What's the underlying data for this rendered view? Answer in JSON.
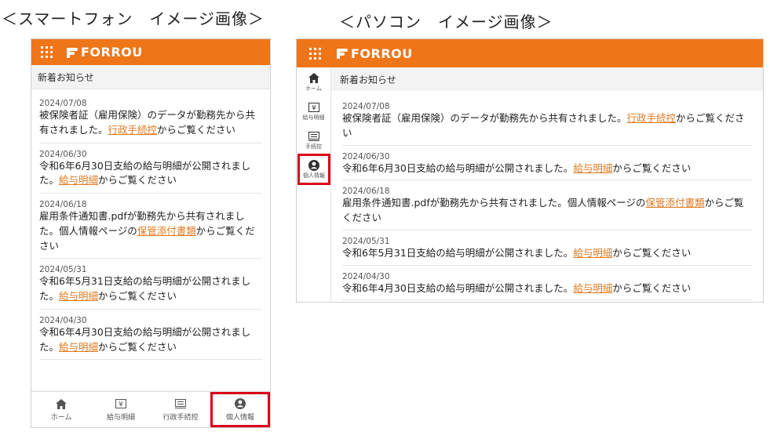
{
  "captions": {
    "smartphone": "＜スマートフォン　イメージ画像＞",
    "pc": "＜パソコン　イメージ画像＞"
  },
  "app": {
    "logo_text": "FORROU"
  },
  "section_title": "新着お知らせ",
  "phone_notices": [
    {
      "date": "2024/07/08",
      "before": "被保険者証（雇用保険）のデータが勤務先から共有されました。",
      "link": "行政手続控",
      "after": "からご覧ください"
    },
    {
      "date": "2024/06/30",
      "before": "令和6年6月30日支給の給与明細が公開されました。",
      "link": "給与明細",
      "after": "からご覧ください"
    },
    {
      "date": "2024/06/18",
      "before": "雇用条件通知書.pdfが勤務先から共有されました。個人情報ページの",
      "link": "保管添付書類",
      "after": "からご覧ください"
    },
    {
      "date": "2024/05/31",
      "before": "令和6年5月31日支給の給与明細が公開されました。",
      "link": "給与明細",
      "after": "からご覧ください"
    },
    {
      "date": "2024/04/30",
      "before": "令和6年4月30日支給の給与明細が公開されました。",
      "link": "給与明細",
      "after": "からご覧ください"
    }
  ],
  "tabs": [
    {
      "label": "ホーム",
      "icon": "home-icon"
    },
    {
      "label": "給与明細",
      "icon": "yen-icon"
    },
    {
      "label": "行政手続控",
      "icon": "document-icon"
    },
    {
      "label": "個人情報",
      "icon": "person-icon",
      "highlighted": true
    }
  ],
  "side_nav": [
    {
      "label": "ホーム",
      "icon": "home-icon"
    },
    {
      "label": "給与明細",
      "icon": "yen-icon"
    },
    {
      "label": "手続控",
      "icon": "document-icon"
    },
    {
      "label": "個人情報",
      "icon": "person-icon",
      "highlighted": true
    }
  ],
  "pc_notices": [
    {
      "date": "2024/07/08",
      "before": "被保険者証（雇用保険）のデータが勤務先から共有されました。",
      "link": "行政手続控",
      "after": "からご覧ください"
    },
    {
      "date": "2024/06/30",
      "before": "令和6年6月30日支給の給与明細が公開されました。",
      "link": "給与明細",
      "after": "からご覧ください"
    },
    {
      "date": "2024/06/18",
      "before": "雇用条件通知書.pdfが勤務先から共有されました。個人情報ページの",
      "link": "保管添付書類",
      "after": "からご覧ください"
    },
    {
      "date": "2024/05/31",
      "before": "令和6年5月31日支給の給与明細が公開されました。",
      "link": "給与明細",
      "after": "からご覧ください"
    },
    {
      "date": "2024/04/30",
      "before": "令和6年4月30日支給の給与明細が公開されました。",
      "link": "給与明細",
      "after": "からご覧ください"
    }
  ],
  "colors": {
    "brand": "#ef7519",
    "link": "#e07a20",
    "highlight": "#d9001b"
  }
}
